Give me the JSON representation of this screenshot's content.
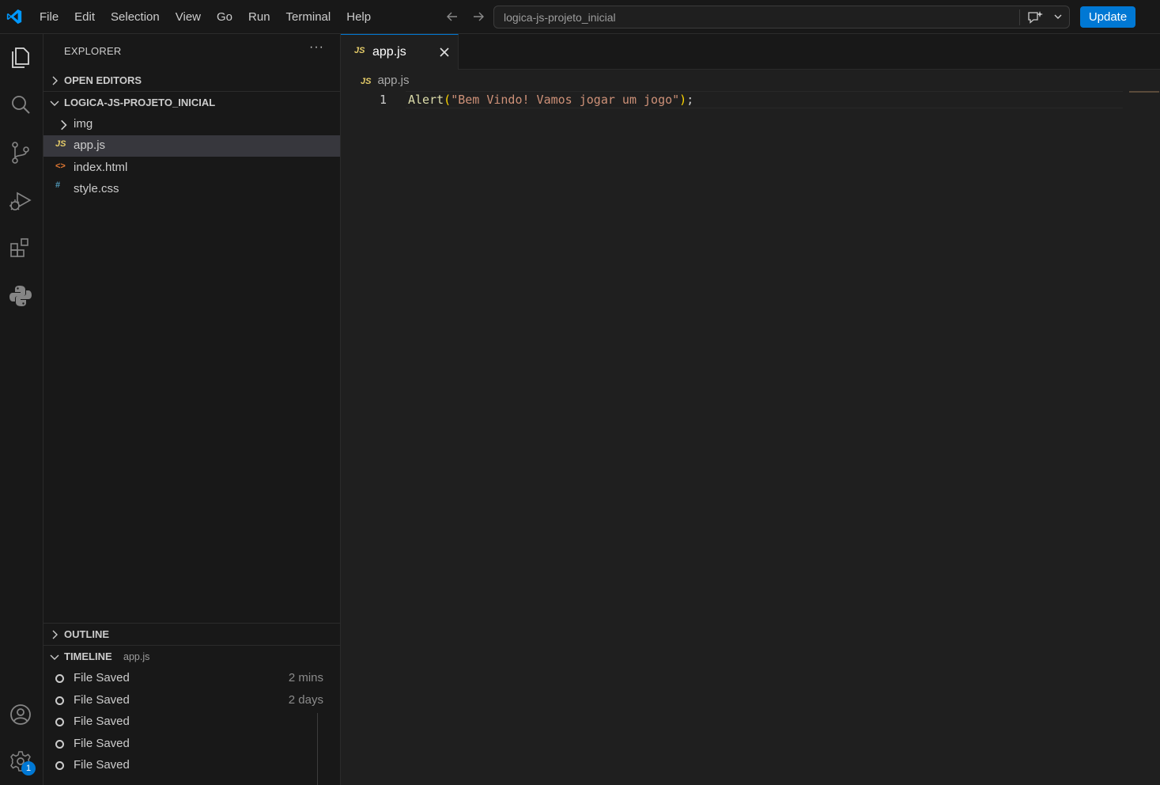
{
  "menu": [
    "File",
    "Edit",
    "Selection",
    "View",
    "Go",
    "Run",
    "Terminal",
    "Help"
  ],
  "command_center": {
    "text": "logica-js-projeto_inicial"
  },
  "update_button": "Update",
  "activity_badge": "1",
  "sidebar": {
    "title": "EXPLORER",
    "more": "···",
    "open_editors": "OPEN EDITORS",
    "project": "LOGICA-JS-PROJETO_INICIAL",
    "files": [
      {
        "name": "img",
        "type": "folder"
      },
      {
        "name": "app.js",
        "type": "js",
        "icon_label": "JS"
      },
      {
        "name": "index.html",
        "type": "html",
        "icon_label": "<>"
      },
      {
        "name": "style.css",
        "type": "css",
        "icon_label": "#"
      }
    ],
    "outline": "OUTLINE",
    "timeline": "TIMELINE",
    "timeline_file": "app.js",
    "timeline_items": [
      {
        "label": "File Saved",
        "time": "2 mins"
      },
      {
        "label": "File Saved",
        "time": "2 days"
      },
      {
        "label": "File Saved",
        "time": ""
      },
      {
        "label": "File Saved",
        "time": ""
      },
      {
        "label": "File Saved",
        "time": ""
      }
    ]
  },
  "editor": {
    "tab": {
      "icon_label": "JS",
      "label": "app.js"
    },
    "breadcrumb": {
      "icon_label": "JS",
      "label": "app.js"
    },
    "line_number": "1",
    "code": {
      "fn": "Alert",
      "open": "(",
      "string": "\"Bem Vindo! Vamos jogar um jogo\"",
      "close": ")",
      "semi": ";"
    }
  },
  "colors": {
    "accent": "#0078d4",
    "background": "#1f1f1f",
    "sidebar": "#181818"
  }
}
